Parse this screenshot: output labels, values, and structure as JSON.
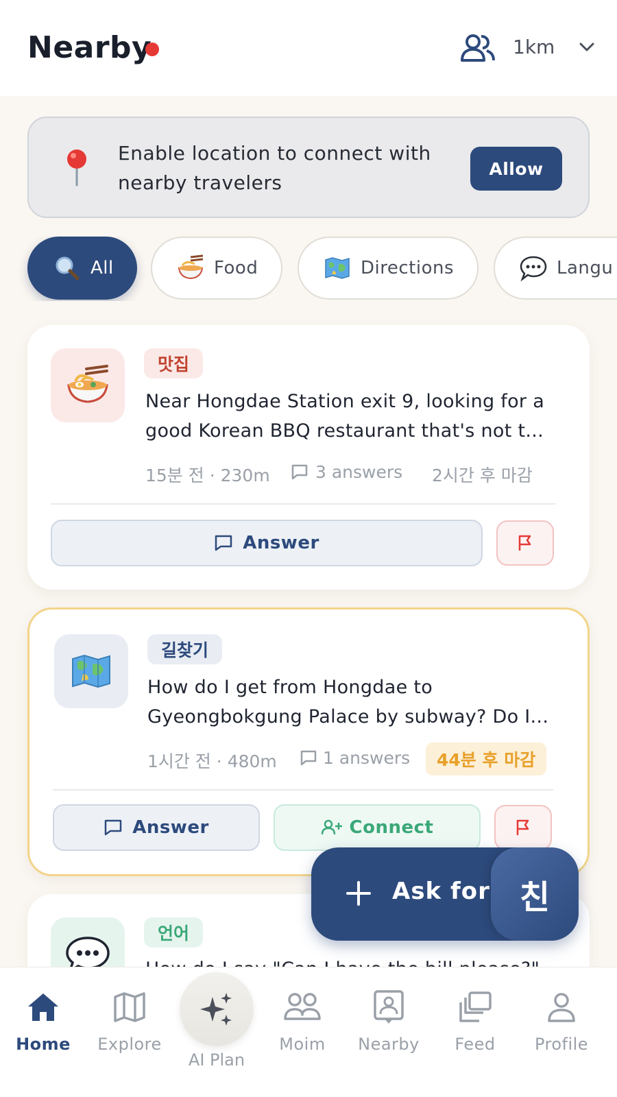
{
  "header": {
    "title": "Nearby",
    "distance": "1km"
  },
  "banner": {
    "text": "Enable location to connect with nearby travelers",
    "allow_label": "Allow"
  },
  "chips": [
    {
      "label": "All",
      "icon": "magnifier-emoji",
      "active": true
    },
    {
      "label": "Food",
      "icon": "noodle-bowl-emoji"
    },
    {
      "label": "Directions",
      "icon": "map-emoji"
    },
    {
      "label": "Langu",
      "icon": "speech-bubble-emoji"
    }
  ],
  "cards": [
    {
      "tag": "맛집",
      "icon": "noodle-bowl-emoji",
      "question": "Near Hongdae Station exit 9, looking for a good Korean BBQ restaurant that's not t...",
      "meta": "15분 전 · 230m",
      "answers": "3 answers",
      "deadline": "2시간 후 마감",
      "answer_label": "Answer"
    },
    {
      "tag": "길찾기",
      "icon": "map-emoji",
      "question": "How do I get from Hongdae to Gyeongbokgung Palace by subway? Do I...",
      "meta": "1시간 전 · 480m",
      "answers": "1 answers",
      "deadline": "44분 후 마감",
      "answer_label": "Answer",
      "connect_label": "Connect"
    },
    {
      "tag": "언어",
      "icon": "speech-bubble-icon",
      "question": "How do I say \"Can I have the bill please?\""
    }
  ],
  "fab": {
    "label": "Ask for h",
    "avatar_text": "친"
  },
  "nav": [
    {
      "label": "Home",
      "icon": "home-icon",
      "active": true
    },
    {
      "label": "Explore",
      "icon": "map-icon"
    },
    {
      "label": "AI Plan",
      "icon": "sparkle-icon"
    },
    {
      "label": "Moim",
      "icon": "group-icon"
    },
    {
      "label": "Nearby",
      "icon": "nearby-badge-icon"
    },
    {
      "label": "Feed",
      "icon": "feed-icon"
    },
    {
      "label": "Profile",
      "icon": "profile-icon"
    }
  ],
  "colors": {
    "primary": "#2d4a7c",
    "accent_red": "#e53935",
    "connect_green": "#3aa878",
    "deadline_orange": "#e8a02a"
  }
}
